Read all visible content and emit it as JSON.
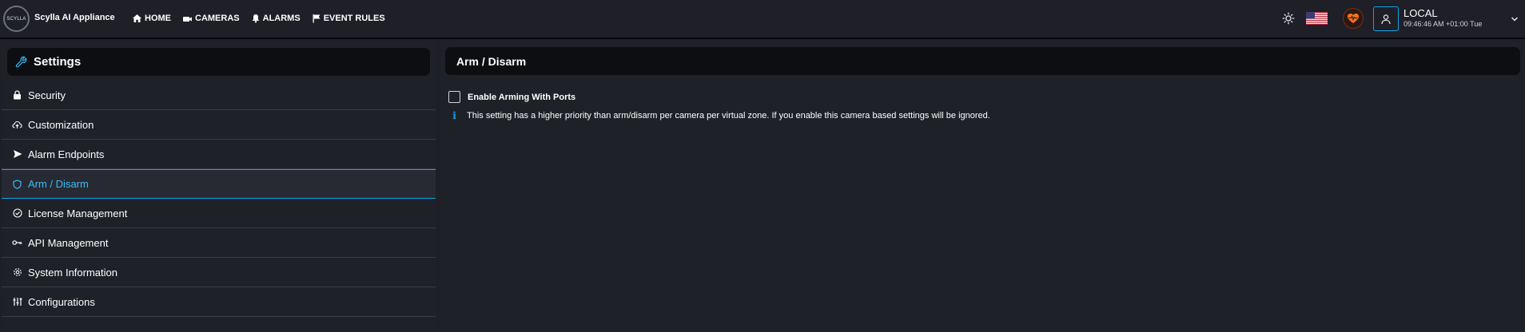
{
  "header": {
    "logo_text": "SCYLLA",
    "brand": "Scylla AI Appliance",
    "nav": [
      {
        "label": "HOME",
        "icon": "home-icon"
      },
      {
        "label": "CAMERAS",
        "icon": "camera-icon"
      },
      {
        "label": "ALARMS",
        "icon": "bell-icon"
      },
      {
        "label": "EVENT RULES",
        "icon": "flag-icon"
      }
    ],
    "user": {
      "name": "LOCAL",
      "time": "09:46:46 AM +01:00 Tue"
    }
  },
  "sidebar": {
    "title": "Settings",
    "items": [
      {
        "label": "Security",
        "icon": "lock-icon"
      },
      {
        "label": "Customization",
        "icon": "cloud-upload-icon"
      },
      {
        "label": "Alarm Endpoints",
        "icon": "send-icon"
      },
      {
        "label": "Arm / Disarm",
        "icon": "shield-icon",
        "active": true
      },
      {
        "label": "License Management",
        "icon": "check-circle-icon"
      },
      {
        "label": "API Management",
        "icon": "key-icon"
      },
      {
        "label": "System Information",
        "icon": "gear-icon"
      },
      {
        "label": "Configurations",
        "icon": "sliders-icon"
      }
    ]
  },
  "main": {
    "title": "Arm / Disarm",
    "checkbox_label": "Enable Arming With Ports",
    "checkbox_checked": false,
    "info_text": "This setting has a higher priority than arm/disarm per camera per virtual zone. If you enable this camera based settings will be ignored."
  },
  "colors": {
    "background": "#1e1f27",
    "panel": "#1f2128",
    "header_bar": "#0d0e12",
    "accent": "#0ea5e9"
  }
}
